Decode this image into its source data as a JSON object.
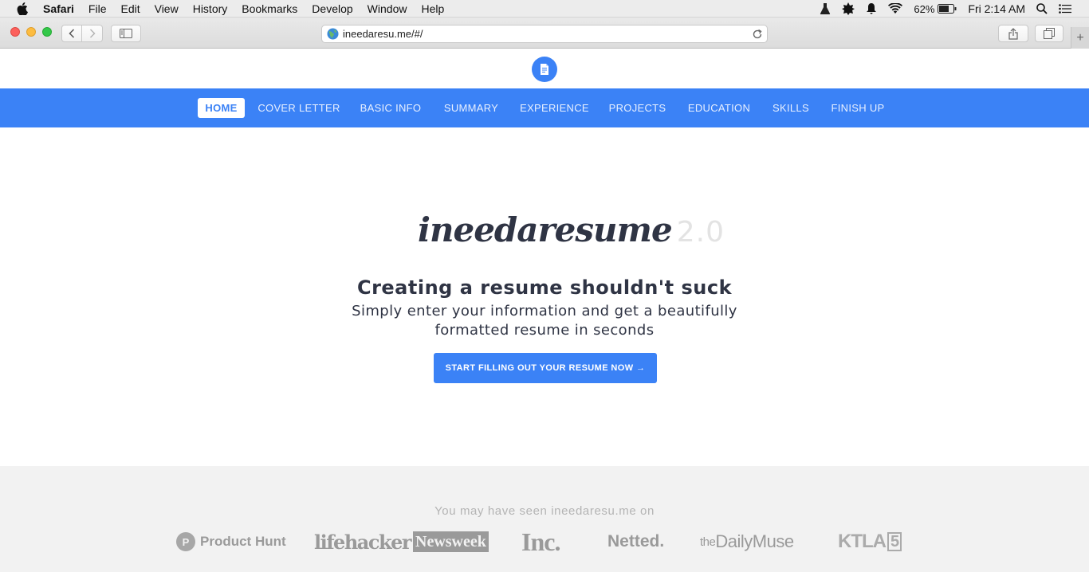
{
  "menubar": {
    "app_name": "Safari",
    "items": [
      "File",
      "Edit",
      "View",
      "History",
      "Bookmarks",
      "Develop",
      "Window",
      "Help"
    ],
    "battery": "62%",
    "clock": "Fri 2:14 AM"
  },
  "browser": {
    "url": "ineedaresu.me/#/"
  },
  "nav": {
    "items": [
      "HOME",
      "COVER LETTER",
      "BASIC INFO",
      "SUMMARY",
      "EXPERIENCE",
      "PROJECTS",
      "EDUCATION",
      "SKILLS",
      "FINISH UP"
    ],
    "active": "HOME"
  },
  "hero": {
    "brand_name": "ineedaresume",
    "brand_version": "2.0",
    "headline": "Creating a resume shouldn't suck",
    "subline": "Simply enter your information and get a beautifully formatted resume in seconds",
    "cta_label": "START FILLING OUT YOUR RESUME NOW →"
  },
  "press": {
    "title": "You may have seen ineedaresu.me on",
    "logos": {
      "product_hunt": "Product Hunt",
      "product_hunt_mark": "P",
      "lifehacker": "lifehacker",
      "newsweek": "Newsweek",
      "inc": "Inc.",
      "netted": "Netted.",
      "daily_muse_prefix": "the",
      "daily_muse": "DailyMuse",
      "ktla": "KTLA",
      "ktla_num": "5"
    }
  },
  "colors": {
    "brand_blue": "#3b82f6",
    "text_dark": "#2f3444"
  }
}
